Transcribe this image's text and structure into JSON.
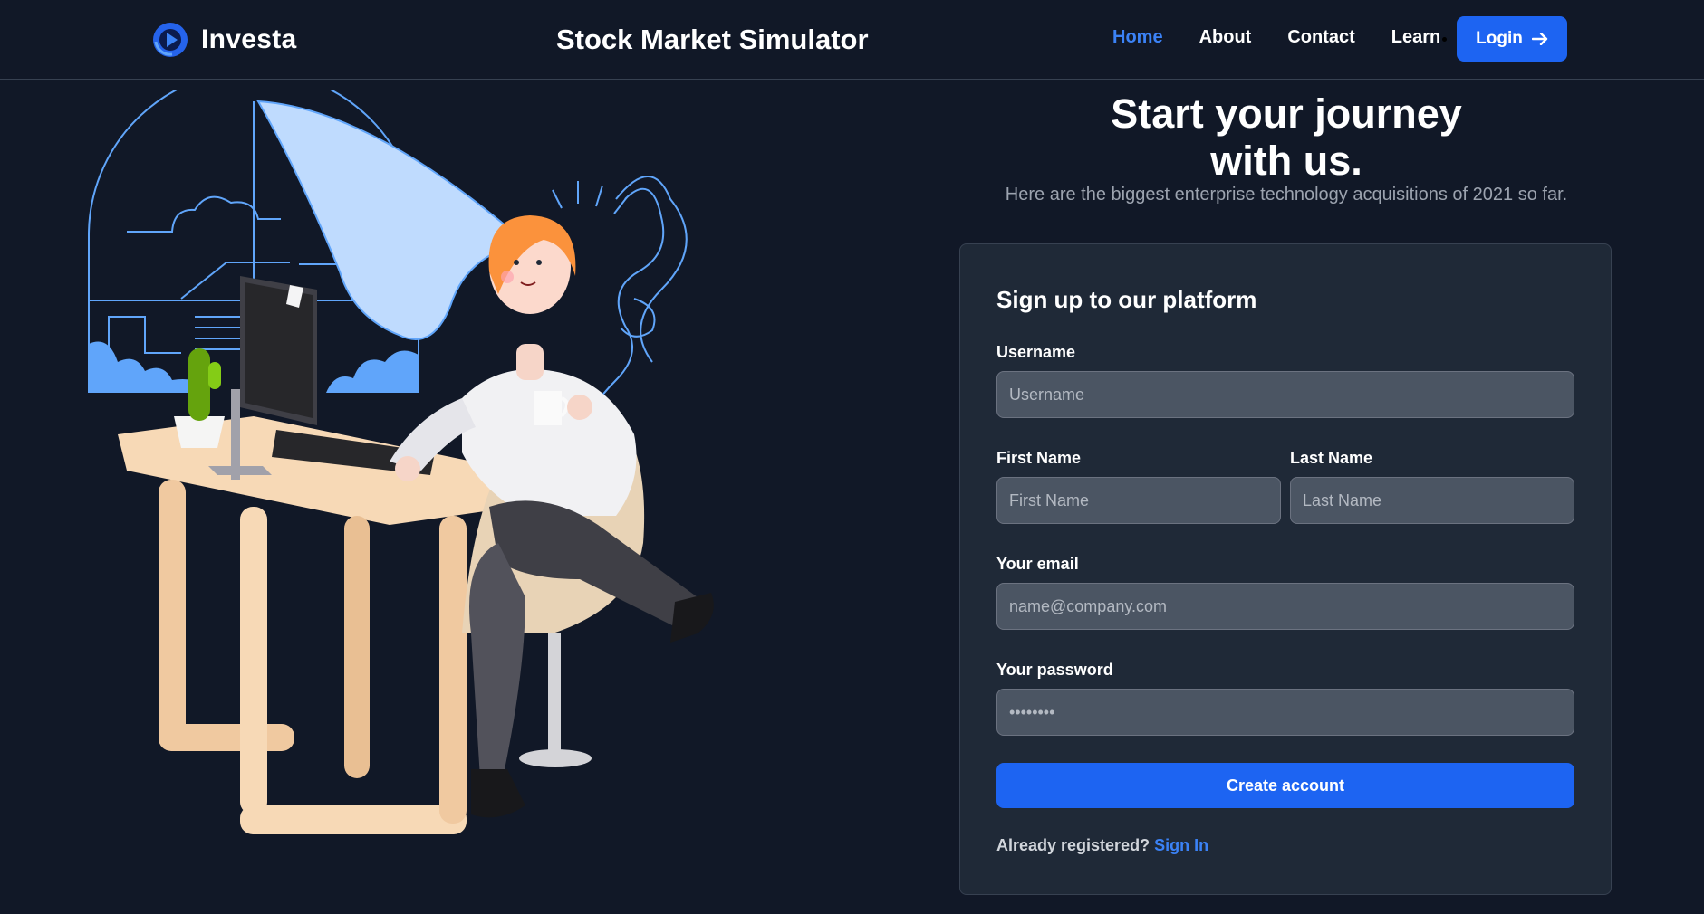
{
  "navbar": {
    "brand_name": "Investa",
    "brand_icon": "investa-logo-icon",
    "site_title": "Stock Market Simulator",
    "links": [
      {
        "label": "Home",
        "active": true
      },
      {
        "label": "About",
        "active": false
      },
      {
        "label": "Contact",
        "active": false
      },
      {
        "label": "Learn",
        "active": false
      }
    ],
    "login_label": "Login",
    "login_icon": "arrow-right-icon"
  },
  "hero": {
    "title_line1": "Start your journey",
    "title_line2": "with us.",
    "subtitle": "Here are the biggest enterprise technology acquisitions of 2021 so far."
  },
  "signup": {
    "title": "Sign up to our platform",
    "username_label": "Username",
    "username_placeholder": "Username",
    "first_name_label": "First Name",
    "first_name_placeholder": "First Name",
    "last_name_label": "Last Name",
    "last_name_placeholder": "Last Name",
    "email_label": "Your email",
    "email_placeholder": "name@company.com",
    "password_label": "Your password",
    "password_placeholder": "••••••••",
    "create_button": "Create account",
    "already_text": "Already registered?",
    "signin_link": "Sign In"
  },
  "colors": {
    "background": "#111827",
    "card": "#1f2937",
    "input": "#4b5563",
    "accent": "#1d64f2",
    "link": "#3b82f6"
  }
}
